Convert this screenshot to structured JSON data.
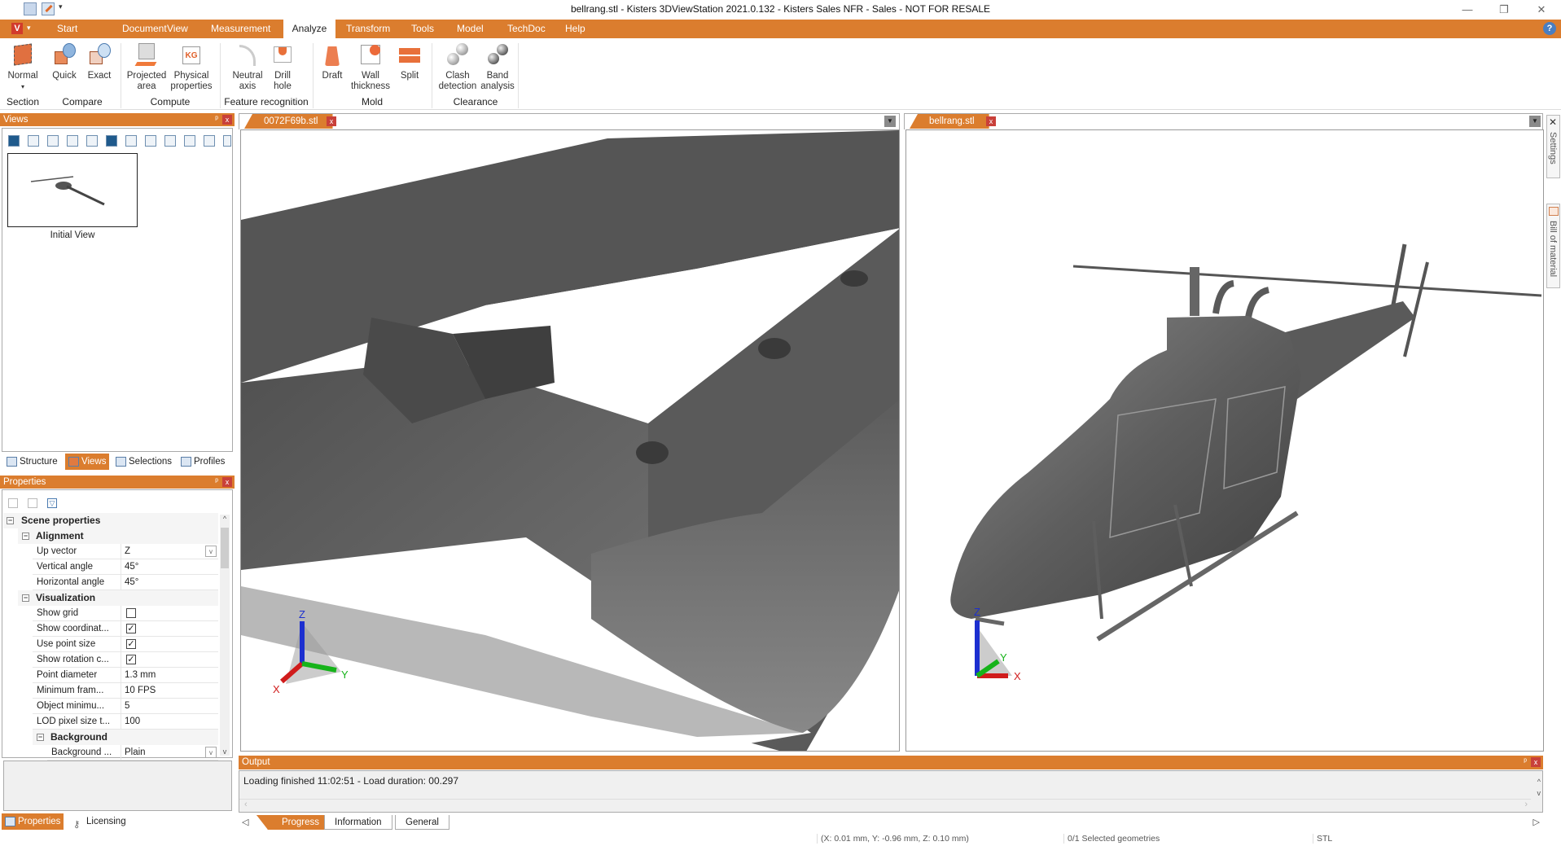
{
  "window": {
    "title": "bellrang.stl - Kisters 3DViewStation 2021.0.132 - Kisters Sales NFR - Sales - NOT FOR RESALE",
    "quick_access": [
      "save-icon",
      "save-as-icon",
      "customize-dropdown-icon"
    ],
    "controls": {
      "minimize": "—",
      "restore": "❐",
      "close": "✕"
    }
  },
  "menubar": {
    "app_button": "V",
    "tabs": [
      {
        "label": "Start"
      },
      {
        "label": "Document"
      },
      {
        "label": "View"
      },
      {
        "label": "Measurement"
      },
      {
        "label": "Analyze",
        "active": true
      },
      {
        "label": "Transform"
      },
      {
        "label": "Tools"
      },
      {
        "label": "Model"
      },
      {
        "label": "TechDoc"
      },
      {
        "label": "Help"
      }
    ],
    "help_icon": "?"
  },
  "ribbon": {
    "buttons": [
      {
        "label": "Normal",
        "sub": "▾",
        "icon": "section-normal-icon"
      },
      {
        "label": "Quick",
        "icon": "compare-quick-icon"
      },
      {
        "label": "Exact",
        "icon": "compare-exact-icon"
      },
      {
        "label": "Projected",
        "label2": "area",
        "icon": "projected-area-icon"
      },
      {
        "label": "Physical",
        "label2": "properties",
        "icon": "physical-properties-icon",
        "badge": "KG"
      },
      {
        "label": "Neutral",
        "label2": "axis",
        "icon": "neutral-axis-icon"
      },
      {
        "label": "Drill",
        "label2": "hole",
        "icon": "drill-hole-icon"
      },
      {
        "label": "Draft",
        "icon": "draft-icon"
      },
      {
        "label": "Wall",
        "label2": "thickness",
        "icon": "wall-thickness-icon"
      },
      {
        "label": "Split",
        "icon": "split-icon"
      },
      {
        "label": "Clash",
        "label2": "detection",
        "icon": "clash-detection-icon"
      },
      {
        "label": "Band",
        "label2": "analysis",
        "icon": "band-analysis-icon"
      }
    ],
    "groups": [
      "Section",
      "Compare",
      "Compute",
      "Feature recognition",
      "Mold",
      "Clearance"
    ]
  },
  "views_panel": {
    "title": "Views",
    "toolbar": [
      "home-icon",
      "add-view-icon",
      "refresh-icon",
      "delete-icon",
      "previous-icon",
      "stop-icon",
      "play-icon",
      "fit-icon",
      "update-view-icon",
      "export-icon",
      "import-icon",
      "pdf-icon"
    ],
    "thumbnails": [
      {
        "label": "Initial View"
      }
    ],
    "tabs": [
      {
        "label": "Structure"
      },
      {
        "label": "Views",
        "active": true
      },
      {
        "label": "Selections"
      },
      {
        "label": "Profiles"
      }
    ]
  },
  "properties_panel": {
    "title": "Properties",
    "root": "Scene properties",
    "groups": [
      {
        "name": "Alignment",
        "rows": [
          {
            "key": "Up vector",
            "value": "Z",
            "dropdown": true
          },
          {
            "key": "Vertical angle",
            "value": "45°"
          },
          {
            "key": "Horizontal angle",
            "value": "45°"
          }
        ]
      },
      {
        "name": "Visualization",
        "rows": [
          {
            "key": "Show grid",
            "checked": false
          },
          {
            "key": "Show coordinat...",
            "checked": true
          },
          {
            "key": "Use point size",
            "checked": true
          },
          {
            "key": "Show rotation c...",
            "checked": true
          },
          {
            "key": "Point diameter",
            "value": "1.3 mm"
          },
          {
            "key": "Minimum fram...",
            "value": "10 FPS"
          },
          {
            "key": "Object minimu...",
            "value": "5"
          },
          {
            "key": "LOD pixel size t...",
            "value": "100"
          }
        ]
      },
      {
        "name": "Background",
        "rows": [
          {
            "key": "Background ...",
            "value": "Plain",
            "dropdown": true
          }
        ]
      }
    ],
    "tabs": [
      {
        "label": "Properties",
        "active": true
      },
      {
        "label": "Licensing"
      }
    ]
  },
  "documents": [
    {
      "tab": "0072F69b.stl",
      "close": "x",
      "model": "Frame part (STL)"
    },
    {
      "tab": "bellrang.stl",
      "close": "x",
      "model": "Helicopter (STL)",
      "active": true
    }
  ],
  "axis_labels": {
    "x": "X",
    "y": "Y",
    "z": "Z"
  },
  "side_tabs": [
    {
      "label": "Settings"
    },
    {
      "label": "Bill of material"
    }
  ],
  "output_panel": {
    "title": "Output",
    "lines": [
      "Loading finished 11:02:51 - Load duration: 00.297"
    ],
    "tabs": [
      {
        "label": "Progress",
        "active": true
      },
      {
        "label": "Information"
      },
      {
        "label": "General"
      }
    ]
  },
  "statusbar": {
    "coordinates": "(X: 0.01 mm, Y: -0.96 mm, Z: 0.10 mm)",
    "selection": "0/1 Selected geometries",
    "format": "STL"
  },
  "colors": {
    "accent": "#db7d2e",
    "close": "#c9403a",
    "model_gray": "#5a5a5a"
  }
}
